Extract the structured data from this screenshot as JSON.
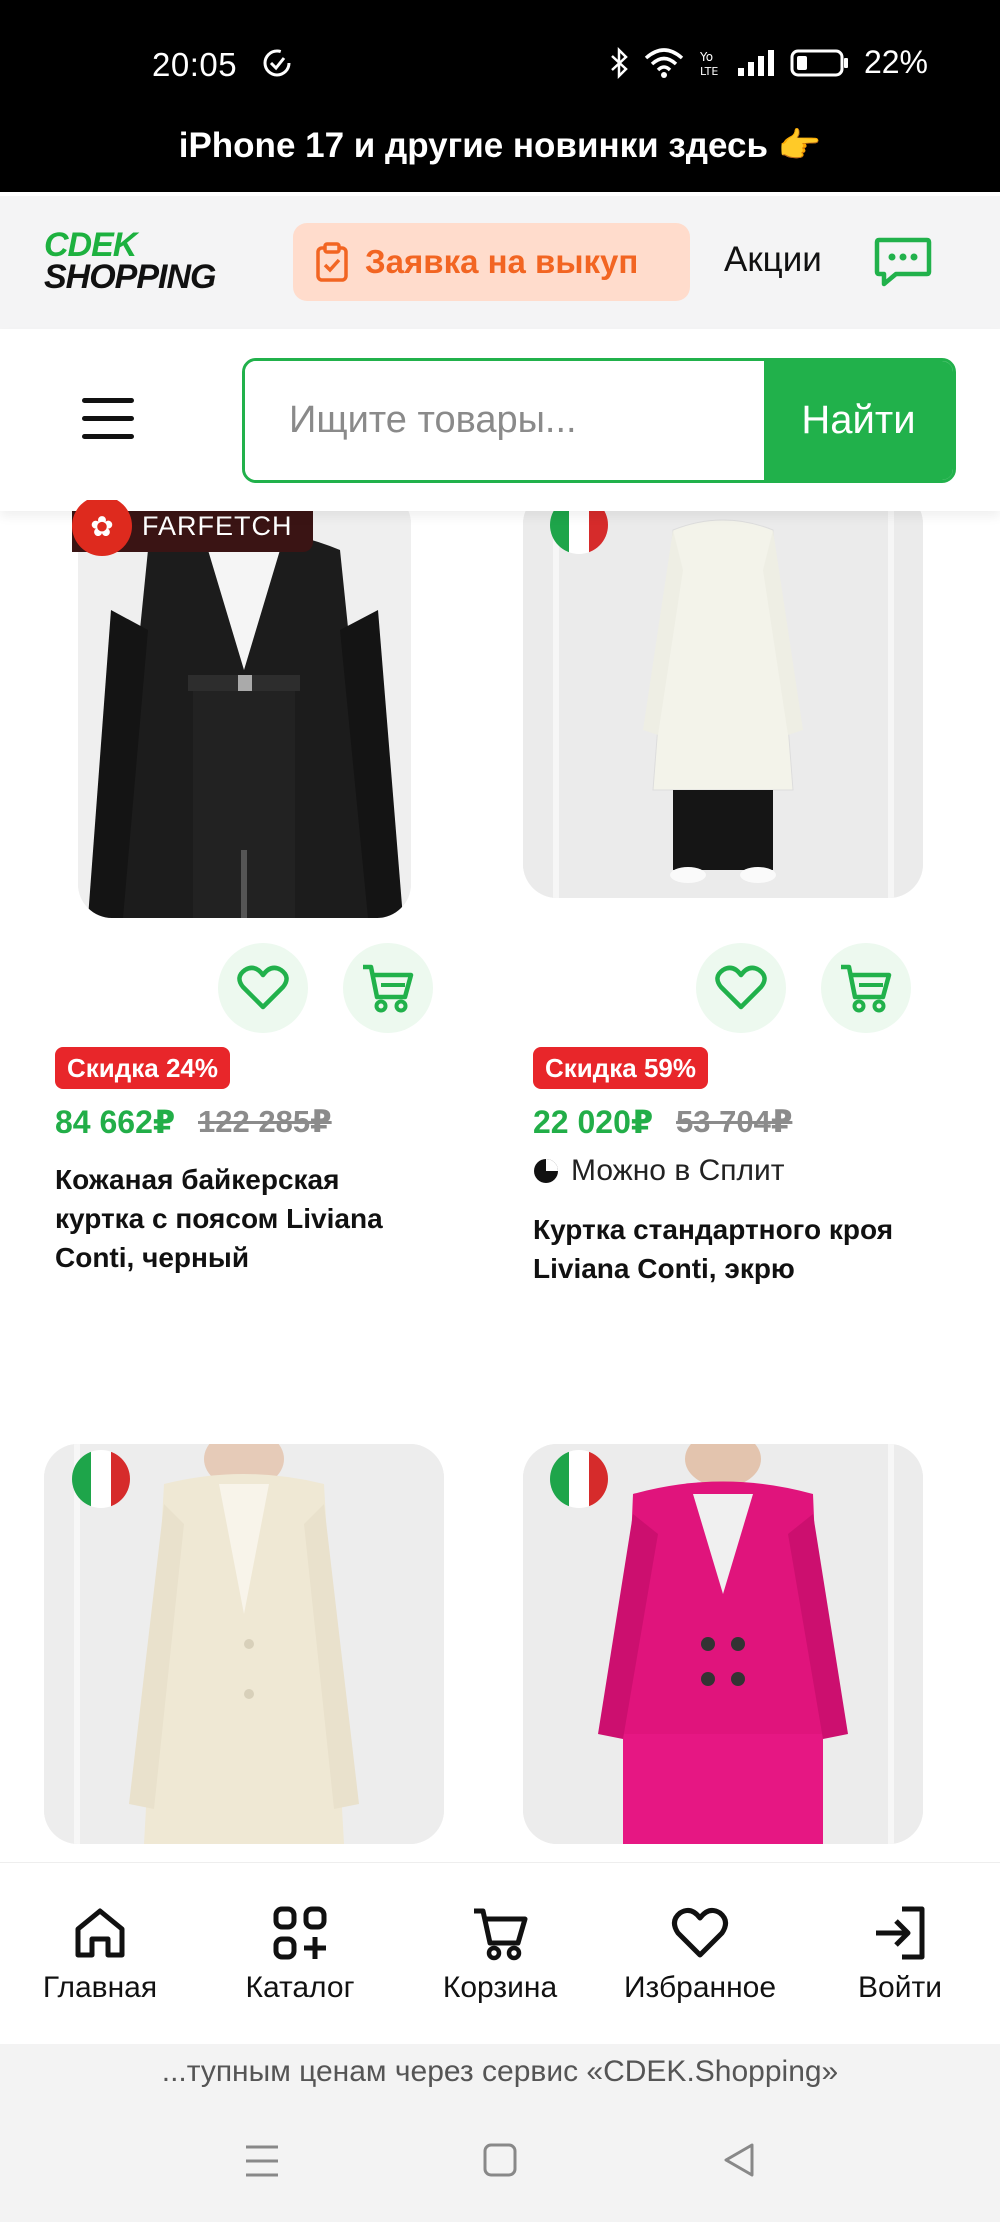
{
  "status_bar": {
    "time": "20:05",
    "battery": "22%"
  },
  "promo_banner": "iPhone 17 и другие новинки здесь 👉",
  "header": {
    "logo_line1": "CDEK",
    "logo_line2": "SHOPPING",
    "buyout_label": "Заявка на выкуп",
    "promo_label": "Акции"
  },
  "search": {
    "placeholder": "Ищите товары...",
    "button_label": "Найти"
  },
  "products": [
    {
      "badge": "FARFETCH",
      "discount": "Скидка 24%",
      "price": "84 662₽",
      "old_price": "122 285₽",
      "title": "Кожаная байкерская куртка с поясом Liviana Conti, черный"
    },
    {
      "discount": "Скидка 59%",
      "price": "22 020₽",
      "old_price": "53 704₽",
      "split": "Можно в Сплит",
      "title": "Куртка стандартного кроя Liviana Conti, экрю"
    }
  ],
  "bottom_nav": [
    {
      "label": "Главная",
      "icon": "home-icon"
    },
    {
      "label": "Каталог",
      "icon": "catalog-icon"
    },
    {
      "label": "Корзина",
      "icon": "cart-icon"
    },
    {
      "label": "Избранное",
      "icon": "heart-icon"
    },
    {
      "label": "Войти",
      "icon": "login-icon"
    }
  ],
  "footer_text": "...тупным ценам через сервис «CDEK.Shopping»",
  "colors": {
    "brand_green": "#21b14b",
    "buyout_orange": "#f26522",
    "discount_red": "#e8262a"
  }
}
